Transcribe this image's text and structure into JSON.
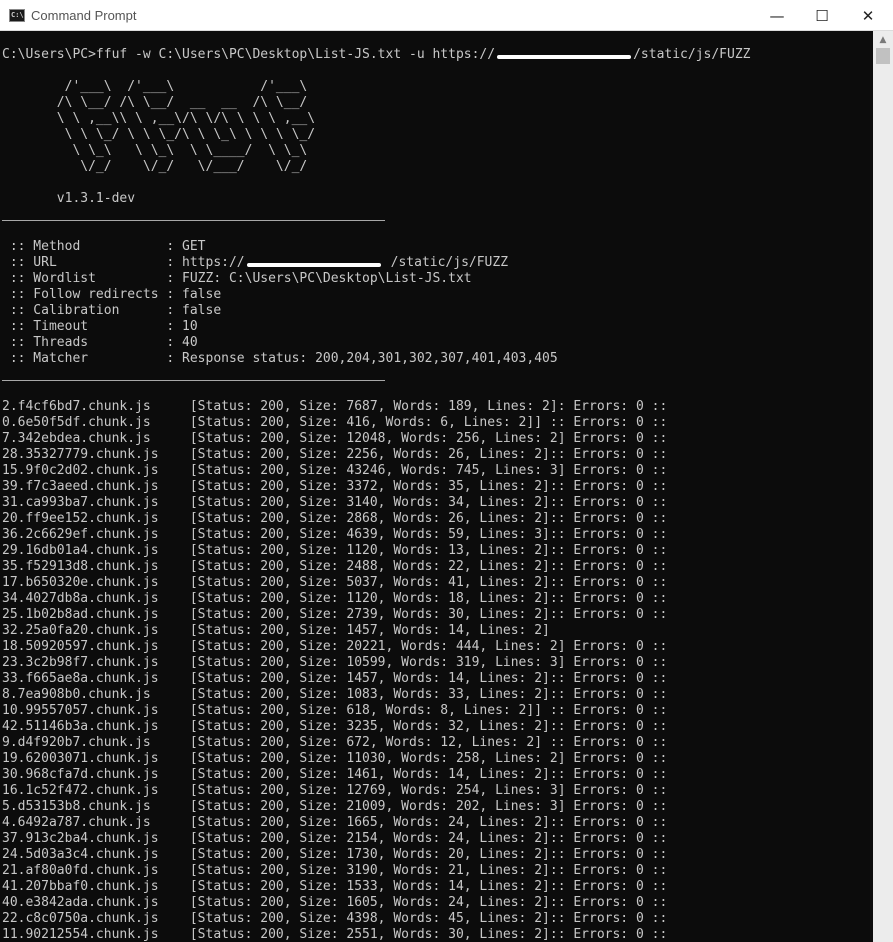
{
  "window": {
    "title": "Command Prompt",
    "icon": "cmd-icon",
    "icon_text": "C:\\",
    "minimize_glyph": "—",
    "maximize_glyph": "☐",
    "close_glyph": "✕"
  },
  "prompt": {
    "before_redact": "C:\\Users\\PC>ffuf -w C:\\Users\\PC\\Desktop\\List-JS.txt -u https://",
    "after_redact": "/static/js/FUZZ"
  },
  "banner": [
    "        /'___\\  /'___\\           /'___\\",
    "       /\\ \\__/ /\\ \\__/  __  __  /\\ \\__/",
    "       \\ \\ ,__\\\\ \\ ,__\\/\\ \\/\\ \\ \\ \\ ,__\\",
    "        \\ \\ \\_/ \\ \\ \\_/\\ \\ \\_\\ \\ \\ \\ \\_/",
    "         \\ \\_\\   \\ \\_\\  \\ \\____/  \\ \\_\\",
    "          \\/_/    \\/_/   \\/___/    \\/_/"
  ],
  "version": "       v1.3.1-dev",
  "config": {
    "method": " :: Method           : GET",
    "url_before": " :: URL              : https://",
    "url_after": "/static/js/FUZZ",
    "wordlist": " :: Wordlist         : FUZZ: C:\\Users\\PC\\Desktop\\List-JS.txt",
    "follow_redirects": " :: Follow redirects : false",
    "calibration": " :: Calibration      : false",
    "timeout": " :: Timeout          : 10",
    "threads": " :: Threads          : 40",
    "matcher": " :: Matcher          : Response status: 200,204,301,302,307,401,403,405"
  },
  "results": [
    "2.f4cf6bd7.chunk.js     [Status: 200, Size: 7687, Words: 189, Lines: 2]: Errors: 0 ::",
    "0.6e50f5df.chunk.js     [Status: 200, Size: 416, Words: 6, Lines: 2]] :: Errors: 0 ::",
    "7.342ebdea.chunk.js     [Status: 200, Size: 12048, Words: 256, Lines: 2] Errors: 0 ::",
    "28.35327779.chunk.js    [Status: 200, Size: 2256, Words: 26, Lines: 2]:: Errors: 0 ::",
    "15.9f0c2d02.chunk.js    [Status: 200, Size: 43246, Words: 745, Lines: 3] Errors: 0 ::",
    "39.f7c3aeed.chunk.js    [Status: 200, Size: 3372, Words: 35, Lines: 2]:: Errors: 0 ::",
    "31.ca993ba7.chunk.js    [Status: 200, Size: 3140, Words: 34, Lines: 2]:: Errors: 0 ::",
    "20.ff9ee152.chunk.js    [Status: 200, Size: 2868, Words: 26, Lines: 2]:: Errors: 0 ::",
    "36.2c6629ef.chunk.js    [Status: 200, Size: 4639, Words: 59, Lines: 3]:: Errors: 0 ::",
    "29.16db01a4.chunk.js    [Status: 200, Size: 1120, Words: 13, Lines: 2]:: Errors: 0 ::",
    "35.f52913d8.chunk.js    [Status: 200, Size: 2488, Words: 22, Lines: 2]:: Errors: 0 ::",
    "17.b650320e.chunk.js    [Status: 200, Size: 5037, Words: 41, Lines: 2]:: Errors: 0 ::",
    "34.4027db8a.chunk.js    [Status: 200, Size: 1120, Words: 18, Lines: 2]:: Errors: 0 ::",
    "25.1b02b8ad.chunk.js    [Status: 200, Size: 2739, Words: 30, Lines: 2]:: Errors: 0 ::",
    "32.25a0fa20.chunk.js    [Status: 200, Size: 1457, Words: 14, Lines: 2]",
    "18.50920597.chunk.js    [Status: 200, Size: 20221, Words: 444, Lines: 2] Errors: 0 ::",
    "23.3c2b98f7.chunk.js    [Status: 200, Size: 10599, Words: 319, Lines: 3] Errors: 0 ::",
    "33.f665ae8a.chunk.js    [Status: 200, Size: 1457, Words: 14, Lines: 2]:: Errors: 0 ::",
    "8.7ea908b0.chunk.js     [Status: 200, Size: 1083, Words: 33, Lines: 2]:: Errors: 0 ::",
    "10.99557057.chunk.js    [Status: 200, Size: 618, Words: 8, Lines: 2]] :: Errors: 0 ::",
    "42.51146b3a.chunk.js    [Status: 200, Size: 3235, Words: 32, Lines: 2]:: Errors: 0 ::",
    "9.d4f920b7.chunk.js     [Status: 200, Size: 672, Words: 12, Lines: 2] :: Errors: 0 ::",
    "19.62003071.chunk.js    [Status: 200, Size: 11030, Words: 258, Lines: 2] Errors: 0 ::",
    "30.968cfa7d.chunk.js    [Status: 200, Size: 1461, Words: 14, Lines: 2]:: Errors: 0 ::",
    "16.1c52f472.chunk.js    [Status: 200, Size: 12769, Words: 254, Lines: 3] Errors: 0 ::",
    "5.d53153b8.chunk.js     [Status: 200, Size: 21009, Words: 202, Lines: 3] Errors: 0 ::",
    "4.6492a787.chunk.js     [Status: 200, Size: 1665, Words: 24, Lines: 2]:: Errors: 0 ::",
    "37.913c2ba4.chunk.js    [Status: 200, Size: 2154, Words: 24, Lines: 2]:: Errors: 0 ::",
    "24.5d03a3c4.chunk.js    [Status: 200, Size: 1730, Words: 20, Lines: 2]:: Errors: 0 ::",
    "21.af80a0fd.chunk.js    [Status: 200, Size: 3190, Words: 21, Lines: 2]:: Errors: 0 ::",
    "41.207bbaf0.chunk.js    [Status: 200, Size: 1533, Words: 14, Lines: 2]:: Errors: 0 ::",
    "40.e3842ada.chunk.js    [Status: 200, Size: 1605, Words: 24, Lines: 2]:: Errors: 0 ::",
    "22.c8c0750a.chunk.js    [Status: 200, Size: 4398, Words: 45, Lines: 2]:: Errors: 0 ::",
    "11.90212554.chunk.js    [Status: 200, Size: 2551, Words: 30, Lines: 2]:: Errors: 0 ::"
  ]
}
